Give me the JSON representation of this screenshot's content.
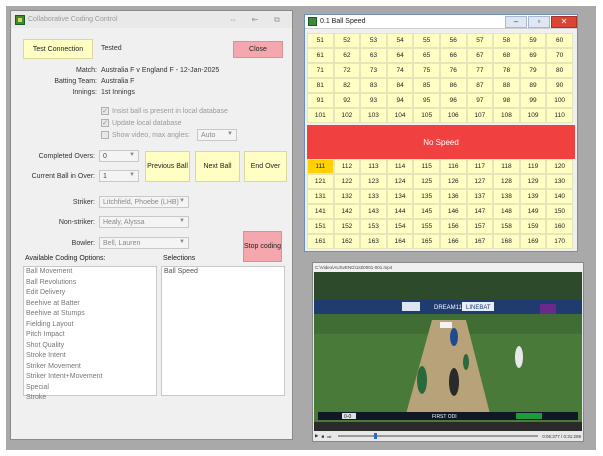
{
  "coding_window": {
    "title": "Collaborative Coding Control",
    "title_buttons": [
      "⇔",
      "⇤",
      "⧉"
    ],
    "test_connection_label": "Test Connection",
    "tested_status": "Tested",
    "close_label": "Close",
    "match_label": "Match:",
    "match_value": "Australia F v England F - 12-Jan-2025",
    "batting_team_label": "Batting Team:",
    "batting_team_value": "Australia F",
    "innings_label": "Innings:",
    "innings_value": "1st Innings",
    "checkboxes": [
      {
        "label": "Insist ball is present in local database",
        "checked": true
      },
      {
        "label": "Update local database",
        "checked": true
      },
      {
        "label": "Show video, max angles:",
        "checked": false
      }
    ],
    "max_angles_value": "Auto",
    "completed_overs_label": "Completed Overs:",
    "completed_overs_value": "0",
    "current_ball_label": "Current Ball in Over:",
    "current_ball_value": "1",
    "previous_ball_label": "Previous Ball",
    "next_ball_label": "Next Ball",
    "end_over_label": "End Over",
    "striker_label": "Striker:",
    "striker_value": "Litchfield, Phoebe (LHB)",
    "non_striker_label": "Non-striker:",
    "non_striker_value": "Healy, Alyssa",
    "bowler_label": "Bowler:",
    "bowler_value": "Bell, Lauren",
    "stop_coding_label": "Stop coding",
    "available_options_label": "Available Coding Options:",
    "available_options": [
      "Ball Movement",
      "Ball Revolutions",
      "Edit Delivery",
      "Beehive at Batter",
      "Beehive at Stumps",
      "Fielding Layout",
      "Pitch Impact",
      "Shot Quality",
      "Stroke Intent",
      "Striker Movement",
      "Striker Intent+Movement",
      "Special",
      "Stroke"
    ],
    "selections_label": "Selections",
    "selections": [
      "Ball Speed"
    ]
  },
  "ball_speed_window": {
    "title": "0.1 Ball Speed",
    "rows_top": [
      [
        "51",
        "52",
        "53",
        "54",
        "55",
        "56",
        "57",
        "58",
        "59",
        "60"
      ],
      [
        "61",
        "62",
        "63",
        "64",
        "65",
        "66",
        "67",
        "68",
        "69",
        "70"
      ],
      [
        "71",
        "72",
        "73",
        "74",
        "75",
        "76",
        "77",
        "78",
        "79",
        "80"
      ],
      [
        "81",
        "82",
        "83",
        "84",
        "85",
        "86",
        "87",
        "88",
        "89",
        "90"
      ],
      [
        "91",
        "92",
        "93",
        "94",
        "95",
        "96",
        "97",
        "98",
        "99",
        "100"
      ],
      [
        "101",
        "102",
        "103",
        "104",
        "105",
        "106",
        "107",
        "108",
        "109",
        "110"
      ]
    ],
    "no_speed_label": "No Speed",
    "rows_bottom": [
      [
        "111",
        "112",
        "113",
        "114",
        "115",
        "116",
        "117",
        "118",
        "119",
        "120"
      ],
      [
        "121",
        "122",
        "123",
        "124",
        "125",
        "126",
        "127",
        "128",
        "129",
        "130"
      ],
      [
        "131",
        "132",
        "133",
        "134",
        "135",
        "136",
        "137",
        "138",
        "139",
        "140"
      ],
      [
        "141",
        "142",
        "143",
        "144",
        "145",
        "146",
        "147",
        "148",
        "149",
        "150"
      ],
      [
        "151",
        "152",
        "153",
        "154",
        "155",
        "156",
        "157",
        "158",
        "159",
        "160"
      ],
      [
        "161",
        "162",
        "163",
        "164",
        "165",
        "166",
        "167",
        "168",
        "169",
        "170"
      ]
    ],
    "selected_value": "111",
    "colors": {
      "cell": "#ffffc4",
      "selected": "#ffd200",
      "no_speed": "#f04040"
    }
  },
  "video_window": {
    "title": "C:\\Video\\AUSvENG\\1st\\0001-001.mp4",
    "scoreboard_score": "0-0",
    "scoreboard_text": "FIRST ODI",
    "boundary_boards": [
      "LINEBAT",
      "DREAM11",
      "LINEBAT"
    ],
    "timecode": "0:05:377 / 0:31:298"
  }
}
